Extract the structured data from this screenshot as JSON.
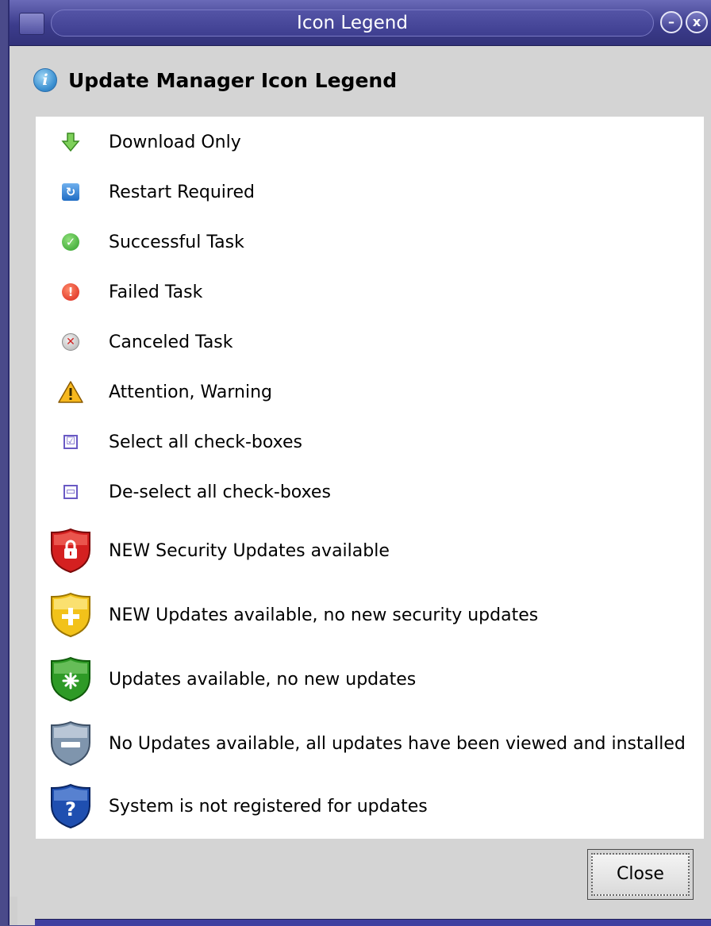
{
  "window": {
    "title": "Icon Legend",
    "minimize_glyph": "–",
    "close_glyph": "x"
  },
  "heading": {
    "icon": "info-icon",
    "icon_glyph": "i",
    "text": "Update Manager Icon Legend"
  },
  "legend": [
    {
      "icon": "download-arrow-icon",
      "label": "Download Only"
    },
    {
      "icon": "restart-icon",
      "label": "Restart Required"
    },
    {
      "icon": "success-check-icon",
      "label": "Successful Task"
    },
    {
      "icon": "failed-exclamation-icon",
      "label": "Failed Task"
    },
    {
      "icon": "canceled-x-icon",
      "label": "Canceled Task"
    },
    {
      "icon": "warning-triangle-icon",
      "label": "Attention, Warning"
    },
    {
      "icon": "select-all-checkbox-icon",
      "label": "Select all check-boxes"
    },
    {
      "icon": "deselect-all-checkbox-icon",
      "label": "De-select all check-boxes"
    },
    {
      "icon": "red-lock-shield-icon",
      "label": "NEW Security Updates available"
    },
    {
      "icon": "yellow-plus-shield-icon",
      "label": "NEW Updates available, no new security updates"
    },
    {
      "icon": "green-star-shield-icon",
      "label": "Updates available, no new updates"
    },
    {
      "icon": "grey-minus-shield-icon",
      "label": "No Updates available, all updates have been viewed and installed"
    },
    {
      "icon": "blue-question-shield-icon",
      "label": "System is not registered for updates"
    }
  ],
  "close_button": {
    "label": "Close"
  },
  "colors": {
    "titlebar": "#3c3c8c",
    "panel": "#ffffff",
    "window_bg": "#d4d4d4",
    "shield_red": "#d42020",
    "shield_yellow": "#f2c21a",
    "shield_green": "#2e9a26",
    "shield_grey": "#7f95ad",
    "shield_blue": "#1f4fb0"
  }
}
